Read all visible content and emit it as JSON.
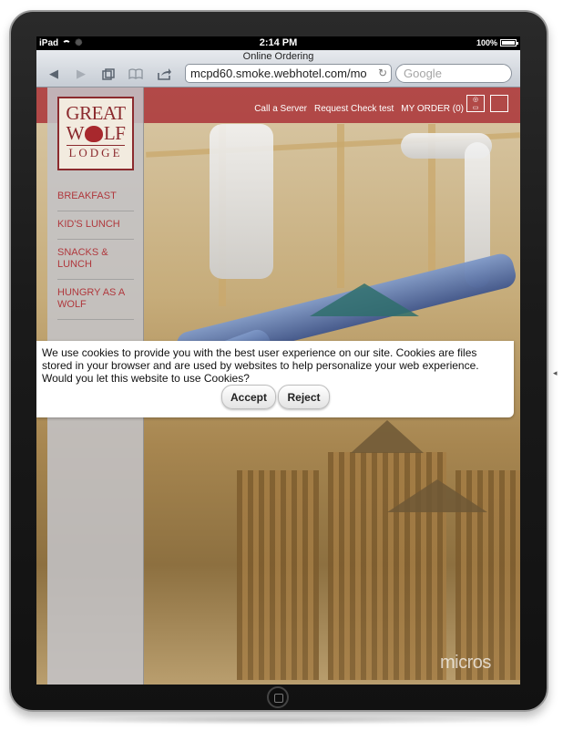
{
  "status_bar": {
    "device": "iPad",
    "time": "2:14 PM",
    "battery": "100%"
  },
  "browser": {
    "page_title": "Online Ordering",
    "url": "mcpd60.smoke.webhotel.com/mo",
    "search_placeholder": "Google",
    "icons": {
      "back": "back-arrow-icon",
      "forward": "forward-arrow-icon",
      "tabs": "tabs-icon",
      "bookmarks": "bookmarks-icon",
      "share": "share-icon",
      "reload": "reload-icon"
    }
  },
  "site": {
    "brand_color": "#aa3237",
    "logo": {
      "line1": "GREAT",
      "line2a": "W",
      "line2b": "LF",
      "line3": "LODGE"
    },
    "top_nav": [
      {
        "label": "Call a Server"
      },
      {
        "label": "Request Check test"
      },
      {
        "label": "MY ORDER (0)"
      }
    ],
    "menu": [
      {
        "label": "BREAKFAST"
      },
      {
        "label": "KID'S LUNCH"
      },
      {
        "label": "SNACKS & LUNCH"
      },
      {
        "label": "HUNGRY AS A WOLF"
      }
    ],
    "watermark": "micros"
  },
  "cookie_dialog": {
    "message": "We use cookies to provide you with the best user experience on our site. Cookies are files stored in your browser and are used by websites to help personalize your web experience. Would you let this website to use Cookies?",
    "accept_label": "Accept",
    "reject_label": "Reject"
  }
}
